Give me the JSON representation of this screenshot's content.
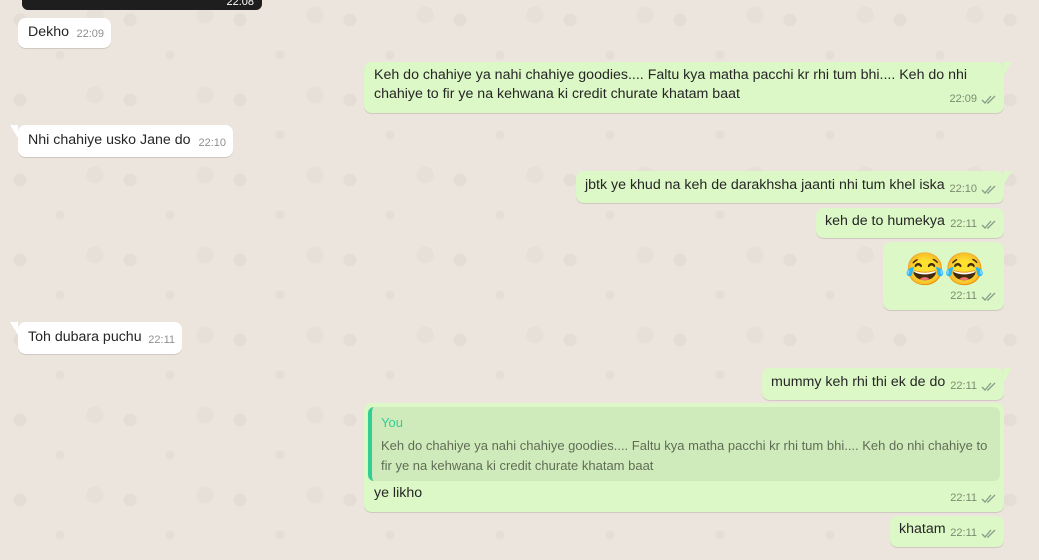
{
  "colors": {
    "incoming_bubble": "#ffffff",
    "outgoing_bubble": "#dcf8c6",
    "chat_background": "#ece5dd",
    "quote_accent": "#35cd96",
    "read_ticks": "#8a9a8a"
  },
  "media_top": {
    "time": "22:08"
  },
  "messages": [
    {
      "direction": "in",
      "text": "Dekho",
      "time": "22:09"
    },
    {
      "direction": "out",
      "text": "Keh do chahiye ya nahi chahiye goodies.... Faltu kya matha pacchi kr rhi tum bhi.... Keh do nhi chahiye to fir ye na kehwana ki credit churate khatam baat",
      "time": "22:09",
      "status": "double-tick-icon"
    },
    {
      "direction": "in",
      "text": "Nhi chahiye usko Jane do",
      "time": "22:10"
    },
    {
      "direction": "out",
      "text": "jbtk ye khud na keh de darakhsha jaanti nhi tum khel iska",
      "time": "22:10",
      "status": "double-tick-icon"
    },
    {
      "direction": "out",
      "text": "keh de to humekya",
      "time": "22:11",
      "status": "double-tick-icon"
    },
    {
      "direction": "out",
      "text": "😂😂",
      "time": "22:11",
      "status": "double-tick-icon"
    },
    {
      "direction": "in",
      "text": "Toh dubara puchu",
      "time": "22:11"
    },
    {
      "direction": "out",
      "text": "mummy keh rhi thi ek de do",
      "time": "22:11",
      "status": "double-tick-icon"
    },
    {
      "direction": "out",
      "quote_author": "You",
      "quote_text": "Keh do chahiye ya nahi chahiye goodies.... Faltu kya matha pacchi kr rhi tum bhi.... Keh do nhi chahiye to fir ye na kehwana ki credit churate khatam baat",
      "text": "ye likho",
      "time": "22:11",
      "status": "double-tick-icon"
    },
    {
      "direction": "out",
      "text": "khatam",
      "time": "22:11",
      "status": "double-tick-icon"
    }
  ]
}
